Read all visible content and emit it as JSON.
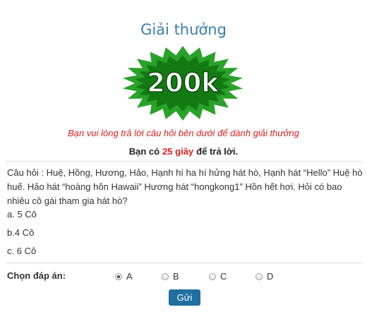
{
  "header": {
    "title": "Giải thưởng"
  },
  "prize": {
    "label": "200k",
    "colors": {
      "outer": "#2aa22a",
      "inner": "#137a13",
      "text": "#ffffff"
    }
  },
  "notice": "Bạn vui lòng trả lời câu hỏi bên dưới để dành giải thưởng",
  "timer": {
    "prefix": "Bạn có",
    "seconds": "25 giây",
    "suffix": "để trả lời."
  },
  "question": {
    "text": "Câu hỏi : Huệ, Hồng, Hương, Hảo, Hạnh hí ha hí hửng hát hò, Hạnh hát “Hello” Huệ hò huế. Hảo hát “hoàng hôn Hawaii” Hương hát “hongkong1” Hồn hết hơi. Hỏi có bao nhiêu cô gái tham gia hát hò?",
    "options": [
      "a. 5 Cô",
      "b.4 Cô",
      "c. 6 Cô"
    ]
  },
  "answer": {
    "label": "Chọn đáp án:",
    "choices": [
      "A",
      "B",
      "C",
      "D"
    ],
    "selected": "A"
  },
  "submit_label": "Gửi"
}
